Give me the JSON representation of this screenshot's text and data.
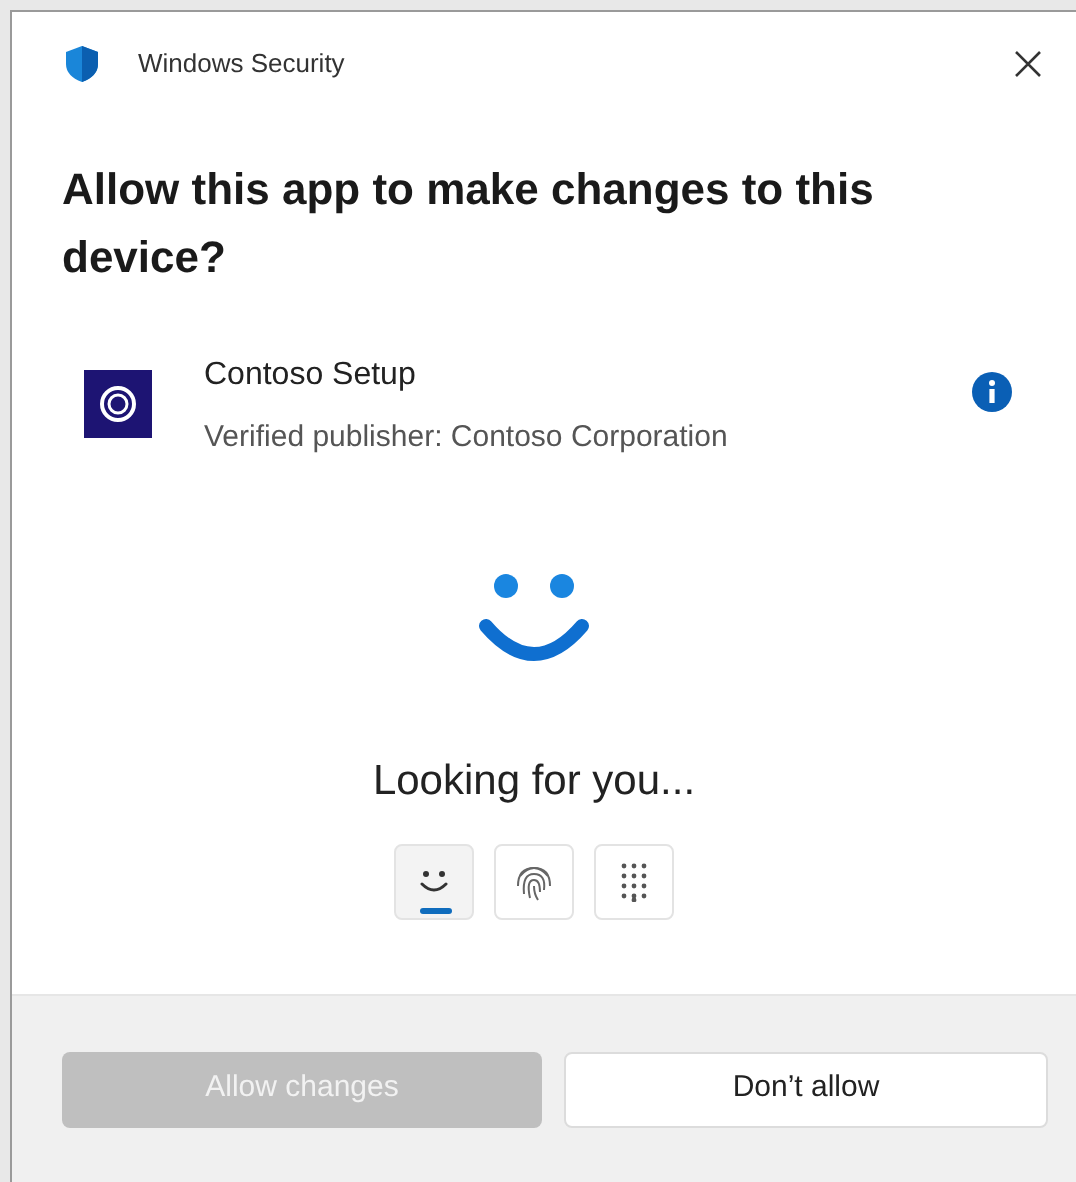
{
  "window": {
    "title": "Windows Security"
  },
  "heading": "Allow this app to make changes to this device?",
  "app": {
    "name": "Contoso Setup",
    "publisher": "Verified publisher: Contoso Corporation"
  },
  "status": "Looking for you...",
  "sign_in_options": [
    {
      "kind": "face",
      "selected": true
    },
    {
      "kind": "fingerprint",
      "selected": false
    },
    {
      "kind": "pin",
      "selected": false
    }
  ],
  "buttons": [
    {
      "label": "Allow changes",
      "disabled": true
    },
    {
      "label": "Don’t allow",
      "disabled": false
    }
  ]
}
